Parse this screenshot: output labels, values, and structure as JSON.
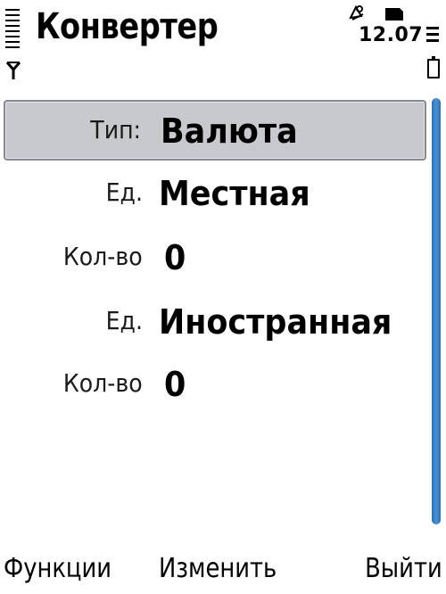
{
  "status_bar": {
    "title": "Конвертер",
    "clock": "12.07",
    "signal_icon": "signal-strength-icon",
    "alarm_icon": "alarm-icon",
    "sim_icon": "sim-card-icon",
    "battery_icon": "battery-icon"
  },
  "form": {
    "fields": [
      {
        "label": "Тип:",
        "value": "Валюта",
        "selected": true
      },
      {
        "label": "Ед.",
        "value": "Местная",
        "selected": false
      },
      {
        "label": "Кол-во",
        "value": "0",
        "selected": false
      },
      {
        "label": "Ед.",
        "value": "Иностранная",
        "selected": false
      },
      {
        "label": "Кол-во",
        "value": "0",
        "selected": false
      }
    ]
  },
  "softkeys": {
    "left": "Функции",
    "middle": "Изменить",
    "right": "Выйти"
  },
  "colors": {
    "highlight": "#c8c9cd",
    "scrollbar": "#3a7fc0",
    "background": "#ffffff"
  }
}
